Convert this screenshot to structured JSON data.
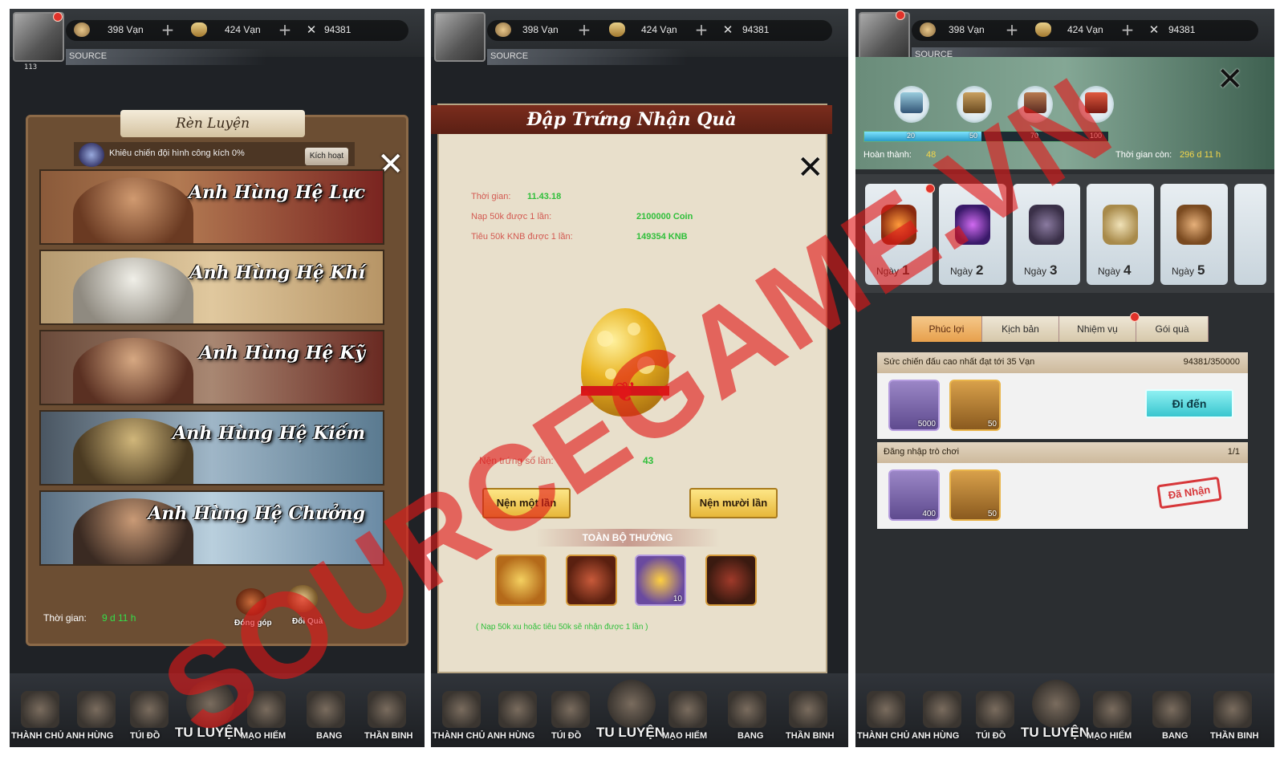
{
  "resources": {
    "coin_label": "398 Vạn",
    "ingot_label": "424 Vạn",
    "power_label": "94381",
    "source_label": "SOURCE",
    "level": "113"
  },
  "nav": [
    "THÀNH CHỦ",
    "ANH HÙNG",
    "TÚI ĐỒ",
    "TU LUYỆN",
    "MẠO HIỂM",
    "BANG",
    "THẦN BINH"
  ],
  "panel1": {
    "title": "Rèn Luyện",
    "buff_text": "Khiêu chiến đội hình công kích 0%",
    "activate_label": "Kích hoạt",
    "heroes": [
      "Anh Hùng Hệ Lực",
      "Anh Hùng Hệ Khí",
      "Anh Hùng Hệ Kỹ",
      "Anh Hùng Hệ Kiếm",
      "Anh Hùng Hệ Chưởng"
    ],
    "time_label": "Thời gian:",
    "time_value": "9 d 11 h",
    "contribute_label": "Đóng góp",
    "exchange_label": "Đổi Quà"
  },
  "panel2": {
    "title": "Đập Trứng Nhận Quà",
    "time_label": "Thời gian:",
    "time_value": "11.43.18",
    "recharge_label": "Nạp 50k được 1 lần:",
    "recharge_value": "2100000 Coin",
    "spend_label": "Tiêu 50k KNB được 1 lần:",
    "spend_value": "149354 KNB",
    "throws_label": "Nện trứng số lần:",
    "throws_value": "43",
    "once_button": "Nện một lần",
    "ten_button": "Nện mười lần",
    "all_rewards": "TOÀN BỘ THƯỞNG",
    "reward_qty": "10",
    "note": "( Nạp 50k xu hoặc tiêu 50k sẽ nhận được 1 lần )"
  },
  "panel3": {
    "milestones": [
      "20",
      "50",
      "70",
      "100"
    ],
    "progress_fraction": 0.48,
    "done_label": "Hoàn thành:",
    "done_value": "48",
    "time_left_label": "Thời gian còn:",
    "time_left_value": "296 d 11 h",
    "day_label": "Ngày",
    "days": [
      "1",
      "2",
      "3",
      "4",
      "5"
    ],
    "tabs": [
      "Phúc lợi",
      "Kịch bản",
      "Nhiệm vụ",
      "Gói quà"
    ],
    "quests": [
      {
        "title": "Sức chiến đấu cao nhất đạt tới 35 Vạn",
        "progress": "94381/350000",
        "reward1": "5000",
        "reward2": "50",
        "action": "Đi đến"
      },
      {
        "title": "Đăng nhập trò chơi",
        "progress": "1/1",
        "reward1": "400",
        "reward2": "50",
        "action": "Đã Nhận"
      }
    ]
  },
  "watermark": "SOURCEGAME.VN",
  "colors": {
    "accent_green": "#33e04a",
    "accent_red": "#e0322a",
    "gold": "#f3d64a",
    "teal_button": "#39c6cf"
  }
}
